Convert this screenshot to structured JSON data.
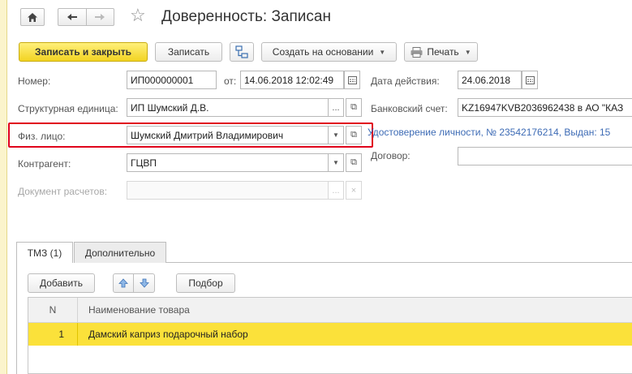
{
  "window": {
    "title": "Доверенность: Записан"
  },
  "toolbar": {
    "save_close": "Записать и закрыть",
    "save": "Записать",
    "create_based": "Создать на основании",
    "print": "Печать"
  },
  "form": {
    "number_label": "Номер:",
    "number_value": "ИП000000001",
    "from_label": "от:",
    "from_value": "14.06.2018 12:02:49",
    "valid_label": "Дата действия:",
    "valid_value": "24.06.2018",
    "unit_label": "Структурная единица:",
    "unit_value": "ИП Шумский Д.В.",
    "bank_label": "Банковский счет:",
    "bank_value": "KZ16947KVB2036962438 в АО \"КАЗ",
    "person_label": "Физ. лицо:",
    "person_value": "Шумский Дмитрий Владимирович",
    "id_link": "Удостоверение личности, № 23542176214, Выдан: 15",
    "contractor_label": "Контрагент:",
    "contractor_value": "ГЦВП",
    "contract_label": "Договор:",
    "contract_value": "",
    "settlement_label": "Документ расчетов:",
    "settlement_value": ""
  },
  "tabs": [
    {
      "label": "ТМЗ (1)"
    },
    {
      "label": "Дополнительно"
    }
  ],
  "table_toolbar": {
    "add": "Добавить",
    "pick": "Подбор"
  },
  "table": {
    "col_n": "N",
    "col_name": "Наименование товара",
    "rows": [
      {
        "n": "1",
        "name": "Дамский каприз подарочный набор"
      }
    ]
  },
  "icons": {
    "home": "home-icon",
    "back": "arrow-left-icon",
    "forward": "arrow-right-icon",
    "star": "star-icon",
    "structure": "structure-icon",
    "print": "printer-icon",
    "calendar": "calendar-icon",
    "open": "open-form-icon",
    "dropdown": "triangle-down-icon",
    "more": "ellipsis-icon",
    "clear": "clear-x-icon",
    "up": "arrow-up-icon",
    "down": "arrow-down-icon"
  },
  "colors": {
    "accent": "#f2d322",
    "selection": "#fbe13a",
    "highlight_frame": "#e0001b",
    "link": "#3d6bb5"
  }
}
